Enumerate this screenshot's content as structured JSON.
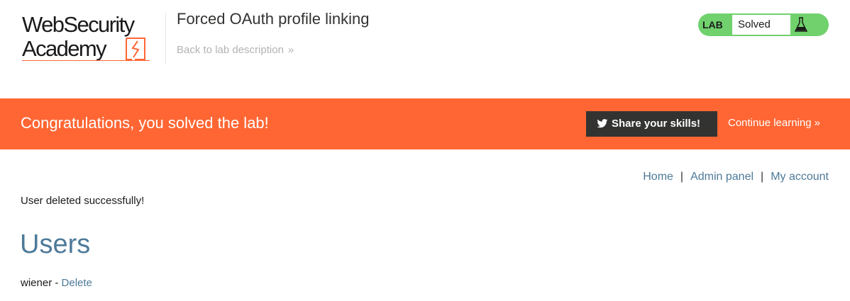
{
  "header": {
    "logo_line1": "WebSecurity",
    "logo_line2": "Academy",
    "lab_title": "Forced OAuth profile linking",
    "back_link": "Back to lab description",
    "back_chevron": "»",
    "lab_status": {
      "tag": "LAB",
      "status": "Solved",
      "icon": "flask-icon",
      "color": "#70d16d"
    }
  },
  "banner": {
    "message": "Congratulations, you solved the lab!",
    "share_label": "Share your skills!",
    "share_icon": "twitter-icon",
    "continue_label": "Continue learning",
    "continue_chevron": "»",
    "color": "#ff6633"
  },
  "nav": {
    "items": [
      {
        "label": "Home"
      },
      {
        "label": "Admin panel"
      },
      {
        "label": "My account"
      }
    ],
    "separator": "|"
  },
  "main": {
    "message": "User deleted successfully!",
    "heading": "Users",
    "users": [
      {
        "name": "wiener",
        "separator": " - ",
        "action": "Delete"
      }
    ]
  }
}
